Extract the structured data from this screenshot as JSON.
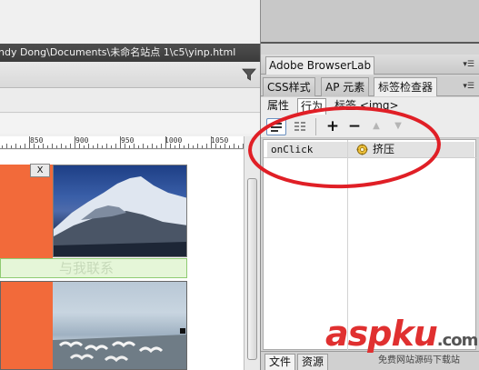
{
  "document": {
    "title_path": "ndy Dong\\Documents\\未命名站点 1\\c5\\yinp.html",
    "ruler_labels": [
      "850",
      "900",
      "950",
      "1000",
      "1050"
    ],
    "close_label": "X",
    "contact_text": "与我联系"
  },
  "panels": {
    "browserlab_tab": "Adobe BrowserLab",
    "tabs": [
      "CSS样式",
      "AP 元素",
      "标签检查器"
    ],
    "sub_tabs": {
      "attributes": "属性",
      "behaviors": "行为",
      "tag": "标签 <img>"
    },
    "toolbar": {
      "add": "+",
      "remove": "−",
      "up": "▲",
      "down": "▼"
    },
    "behaviors": [
      {
        "event": "onClick",
        "action": "挤压",
        "icon": "gear-icon"
      }
    ],
    "bottom_tabs": [
      "文件",
      "资源"
    ]
  },
  "watermark": {
    "logo_text": "aspku",
    "logo_suffix": ".com",
    "tagline": "免费网站源码下载站"
  },
  "colors": {
    "orange": "#f26a3a",
    "annotation_red": "#e01f26",
    "watermark_red": "#e03030"
  }
}
